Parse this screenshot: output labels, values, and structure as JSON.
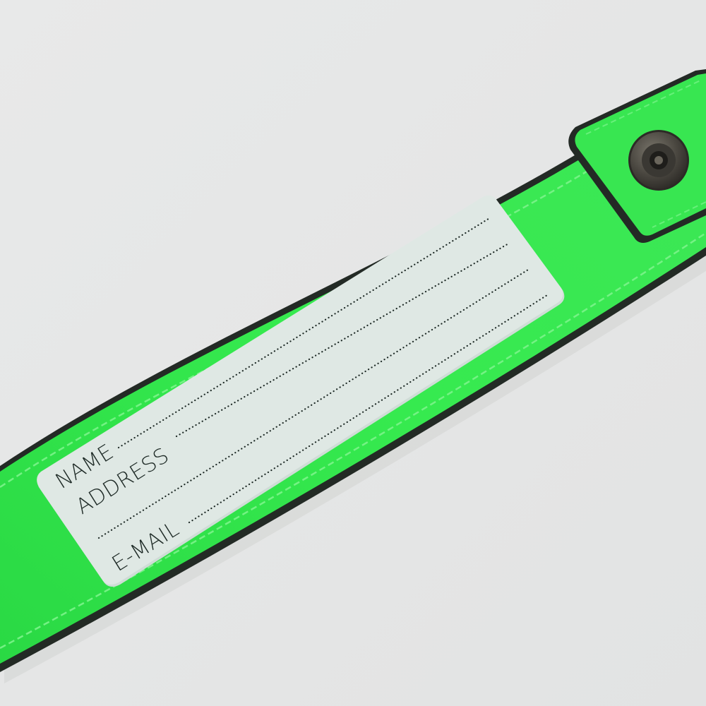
{
  "photo": {
    "subject": "luggage-tag-strap",
    "colors": {
      "background": "#e6e7e7",
      "strap": "#2ee548",
      "strap_edge": "#232a25",
      "stitch": "#7cf38b",
      "card": "#dfe8e4",
      "ink": "#1e2a26",
      "snap_metal": "#4a4740"
    }
  },
  "id_card": {
    "fields": [
      {
        "label": "NAME"
      },
      {
        "label": "ADDRESS"
      },
      {
        "label": "E-MAIL"
      }
    ]
  }
}
